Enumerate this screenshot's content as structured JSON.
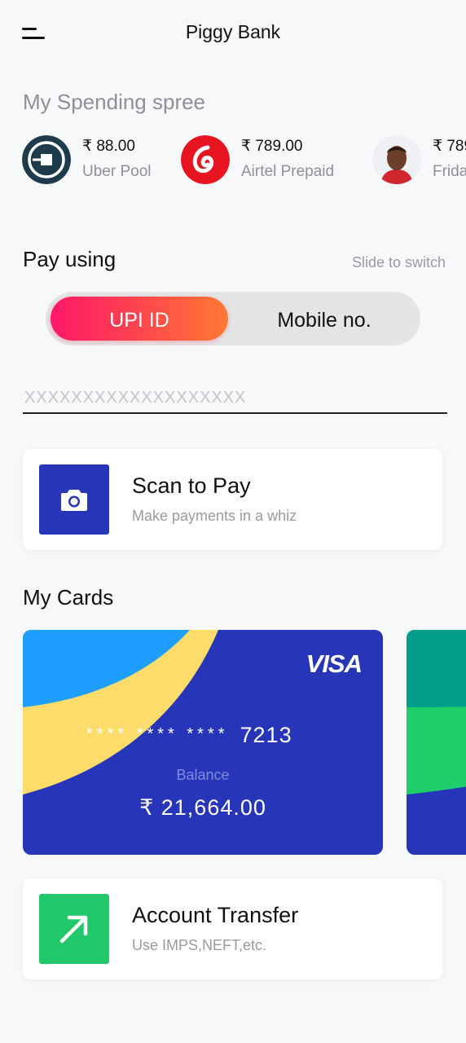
{
  "header": {
    "title": "Piggy Bank"
  },
  "spending": {
    "title": "My Spending spree",
    "items": [
      {
        "amount": "₹ 88.00",
        "name": "Uber Pool",
        "icon": "uber-logo-icon"
      },
      {
        "amount": "₹ 789.00",
        "name": "Airtel Prepaid",
        "icon": "airtel-logo-icon"
      },
      {
        "amount": "₹ 789",
        "name": "Frida",
        "icon": "person-avatar"
      }
    ]
  },
  "pay": {
    "title": "Pay using",
    "hint": "Slide to switch",
    "options": [
      "UPI ID",
      "Mobile no."
    ],
    "selected": "UPI ID",
    "input_placeholder": "XXXXXXXXXXXXXXXXXXX"
  },
  "scan": {
    "title": "Scan to Pay",
    "subtitle": "Make payments in a whiz",
    "icon": "camera-icon"
  },
  "cards": {
    "title": "My Cards",
    "items": [
      {
        "brand": "VISA",
        "masked": "**** **** ****",
        "last4": "7213",
        "balance_label": "Balance",
        "balance": "₹ 21,664.00"
      }
    ]
  },
  "transfer": {
    "title": "Account Transfer",
    "subtitle": "Use IMPS,NEFT,etc.",
    "icon": "arrow-up-right-icon"
  },
  "colors": {
    "card_blue": "#2736b8",
    "card_teal": "#039e8a",
    "card_green": "#1fcd6b",
    "toggle_gradient_start": "#ff1769",
    "toggle_gradient_end": "#ff7a33",
    "card_sky": "#1e9fff",
    "card_yellow": "#fedc6b"
  }
}
